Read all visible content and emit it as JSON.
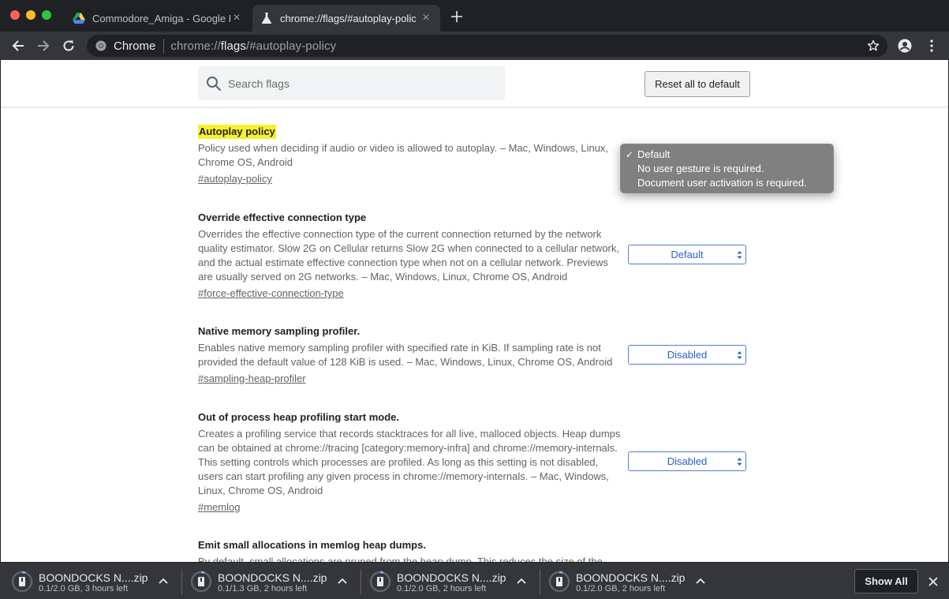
{
  "tabs": [
    {
      "title": "Commodore_Amiga - Google D",
      "icon": "google-drive-icon",
      "active": false
    },
    {
      "title": "chrome://flags/#autoplay-polic",
      "icon": "flask-icon",
      "active": true
    }
  ],
  "omnibox": {
    "chip": "Chrome",
    "url_scheme": "chrome://",
    "url_host": "flags",
    "url_rest": "/#autoplay-policy"
  },
  "header": {
    "search_placeholder": "Search flags",
    "reset_label": "Reset all to default"
  },
  "experiments": [
    {
      "name": "Autoplay policy",
      "description": "Policy used when deciding if audio or video is allowed to autoplay. – Mac, Windows, Linux, Chrome OS, Android",
      "link": "#autoplay-policy",
      "select": null
    },
    {
      "name": "Override effective connection type",
      "description": "Overrides the effective connection type of the current connection returned by the network quality estimator. Slow 2G on Cellular returns Slow 2G when connected to a cellular network, and the actual estimate effective connection type when not on a cellular network. Previews are usually served on 2G networks. – Mac, Windows, Linux, Chrome OS, Android",
      "link": "#force-effective-connection-type",
      "select": "Default"
    },
    {
      "name": "Native memory sampling profiler.",
      "description": "Enables native memory sampling profiler with specified rate in KiB. If sampling rate is not provided the default value of 128 KiB is used. – Mac, Windows, Linux, Chrome OS, Android",
      "link": "#sampling-heap-profiler",
      "select": "Disabled"
    },
    {
      "name": "Out of process heap profiling start mode.",
      "description": "Creates a profiling service that records stacktraces for all live, malloced objects. Heap dumps can be obtained at chrome://tracing [category:memory-infra] and chrome://memory-internals. This setting controls which processes are profiled. As long as this setting is not disabled, users can start profiling any given process in chrome://memory-internals. – Mac, Windows, Linux, Chrome OS, Android",
      "link": "#memlog",
      "select": "Disabled"
    },
    {
      "name": "Emit small allocations in memlog heap dumps.",
      "description": "By default, small allocations are pruned from the heap dump. This reduces the size of the",
      "link": "",
      "select": null
    }
  ],
  "autoplay_popup": {
    "options": [
      "Default",
      "No user gesture is required.",
      "Document user activation is required."
    ],
    "selected": "Default"
  },
  "downloads": [
    {
      "name": "BOONDOCKS N....zip",
      "status": "0.1/2.0 GB, 3 hours left"
    },
    {
      "name": "BOONDOCKS N....zip",
      "status": "0.1/1.3 GB, 2 hours left"
    },
    {
      "name": "BOONDOCKS N....zip",
      "status": "0.1/2.0 GB, 2 hours left"
    },
    {
      "name": "BOONDOCKS N....zip",
      "status": "0.1/2.0 GB, 2 hours left"
    }
  ],
  "shelf": {
    "show_all": "Show All"
  },
  "colors": {
    "highlight": "#f8f12b",
    "select_blue": "#2c5fc9",
    "chrome_dark": "#35363a"
  }
}
